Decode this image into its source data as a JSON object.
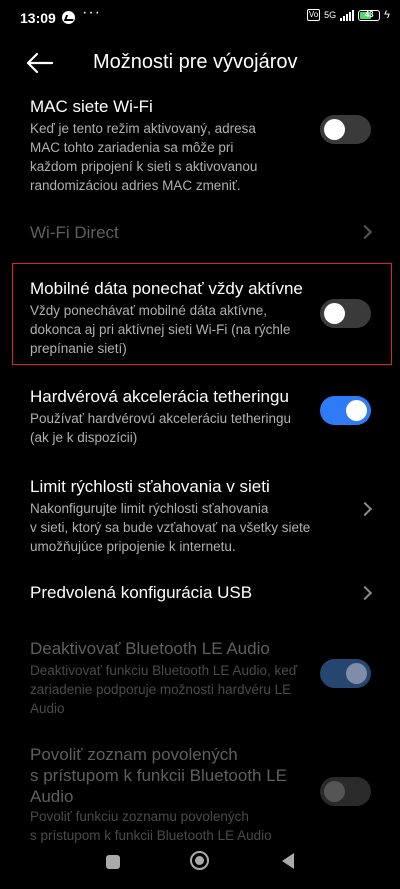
{
  "status_bar": {
    "time": "13:09",
    "network": "5G",
    "volte": "Vo LTE",
    "battery": "43"
  },
  "header": {
    "title": "Možnosti pre vývojárov"
  },
  "items": [
    {
      "title": "MAC siete Wi-Fi",
      "description": "Keď je tento režim aktivovaný, adresa\nMAC tohto zariadenia sa môže pri\nkaždom pripojení k sieti s aktivovanou\nrandomizáciou adries MAC zmeniť.",
      "control": "toggle",
      "state": "off",
      "enabled": true
    },
    {
      "title": "Wi-Fi Direct",
      "description": "",
      "control": "chevron",
      "enabled": false
    },
    {
      "title": "Mobilné dáta ponechať vždy aktívne",
      "description": "Vždy ponechávať mobilné dáta aktívne,\ndokonca aj pri aktívnej sieti Wi-Fi (na rýchle\nprepínanie sietí)",
      "control": "toggle",
      "state": "off",
      "enabled": true,
      "highlighted": true
    },
    {
      "title": "Hardvérová akcelerácia tetheringu",
      "description": "Používať hardvérovú akceleráciu tetheringu\n(ak je k dispozícii)",
      "control": "toggle",
      "state": "on",
      "enabled": true
    },
    {
      "title": "Limit rýchlosti sťahovania v sieti",
      "description": "Nakonfigurujte limit rýchlosti sťahovania\nv sieti, ktorý sa bude vzťahovať na všetky siete\numožňujúce pripojenie k internetu.",
      "control": "chevron",
      "enabled": true
    },
    {
      "title": "Predvolená konfigurácia USB",
      "description": "",
      "control": "chevron",
      "enabled": true
    },
    {
      "title": "Deaktivovať Bluetooth LE Audio",
      "description": "Deaktivovať funkciu Bluetooth LE Audio, keď\nzariadenie podporuje možnosti hardvéru LE\nAudio",
      "control": "toggle",
      "state": "on",
      "enabled": false
    },
    {
      "title": "Povoliť zoznam povolených\ns prístupom k funkcii Bluetooth LE\nAudio",
      "description": "Povoliť funkciu zoznamu povolených\ns prístupom k funkcii Bluetooth LE Audio",
      "control": "toggle",
      "state": "off",
      "enabled": false
    }
  ],
  "colors": {
    "accent": "#2f7bf5",
    "highlight_border": "#d9252b",
    "background": "#000000"
  },
  "nav_bar": {
    "icons": [
      "recents-square-icon",
      "home-circle-icon",
      "back-triangle-icon"
    ]
  }
}
